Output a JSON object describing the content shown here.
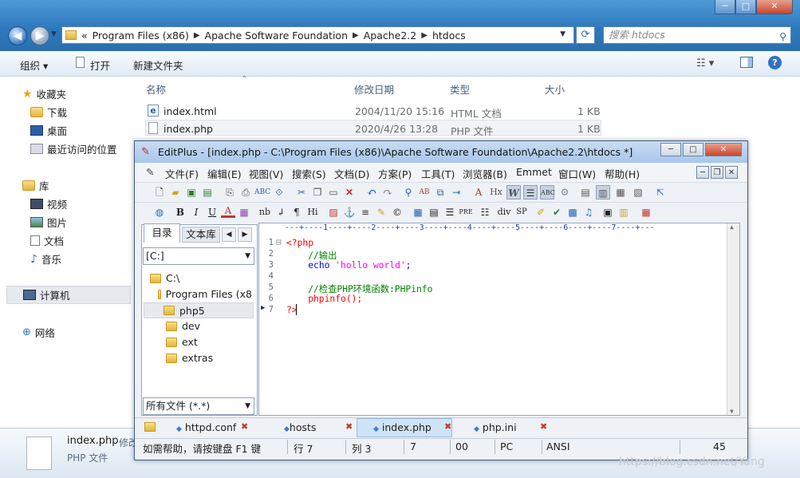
{
  "explorer": {
    "address_prefix": "«",
    "address": [
      "Program Files (x86)",
      "Apache Software Foundation",
      "Apache2.2",
      "htdocs"
    ],
    "search_placeholder": "搜索 htdocs",
    "commands": {
      "organize": "组织 ▾",
      "open": "打开",
      "new_folder": "新建文件夹"
    },
    "sidebar": {
      "favorites": "收藏夹",
      "downloads": "下载",
      "desktop": "桌面",
      "recent": "最近访问的位置",
      "libraries": "库",
      "videos": "视频",
      "pictures": "图片",
      "documents": "文档",
      "music": "音乐",
      "computer": "计算机",
      "network": "网络"
    },
    "columns": {
      "name": "名称",
      "date": "修改日期",
      "type": "类型",
      "size": "大小"
    },
    "files": [
      {
        "name": "index.html",
        "date": "2004/11/20 15:16",
        "type": "HTML 文档",
        "size": "1 KB"
      },
      {
        "name": "index.php",
        "date": "2020/4/26 13:28",
        "type": "PHP 文件",
        "size": "1 KB"
      }
    ],
    "detail": {
      "name": "index.php",
      "extra": "修改",
      "type": "PHP 文件"
    }
  },
  "editplus": {
    "title": "EditPlus - [index.php - C:\\Program Files (x86)\\Apache Software Foundation\\Apache2.2\\htdocs *]",
    "menu": [
      "文件(F)",
      "编辑(E)",
      "视图(V)",
      "搜索(S)",
      "文档(D)",
      "方案(P)",
      "工具(T)",
      "浏览器(B)",
      "Emmet",
      "窗口(W)",
      "帮助(H)"
    ],
    "left_tabs": {
      "dir": "目录",
      "cliptext": "文本库"
    },
    "drive": "[C:]",
    "tree": [
      "C:\\",
      "Program Files (x8",
      "php5",
      "dev",
      "ext",
      "extras"
    ],
    "filter": "所有文件 (*.*)",
    "ruler": "---+----1----+----2----+----3----+----4----+----5----+----6----+----7----+---",
    "code": [
      {
        "n": "1",
        "text": "<?php"
      },
      {
        "n": "2",
        "text": "    //输出"
      },
      {
        "n": "3",
        "text_kw": "echo",
        "text_str": "'hollo world'",
        "text_end": ";"
      },
      {
        "n": "4",
        "text": ""
      },
      {
        "n": "5",
        "text": "    //检查PHP环境函数:PHPinfo"
      },
      {
        "n": "6",
        "text": "    phpinfo();"
      },
      {
        "n": "7",
        "text": "?>"
      }
    ],
    "file_tabs": [
      "httpd.conf",
      "hosts",
      "index.php",
      "php.ini"
    ],
    "status": {
      "help": "如需帮助，请按键盘 F1 键",
      "line": "行 7",
      "col": "列 3",
      "n1": "7",
      "n2": "00",
      "eol": "PC",
      "enc": "ANSI",
      "n3": "45"
    }
  },
  "watermark": "https://blog.csdn.net/Yang",
  "colors": {
    "accent": "#2d79bd",
    "keyword": "#0000ff",
    "comment": "#008000",
    "string": "#ff00ff",
    "tag": "#ff0000"
  }
}
